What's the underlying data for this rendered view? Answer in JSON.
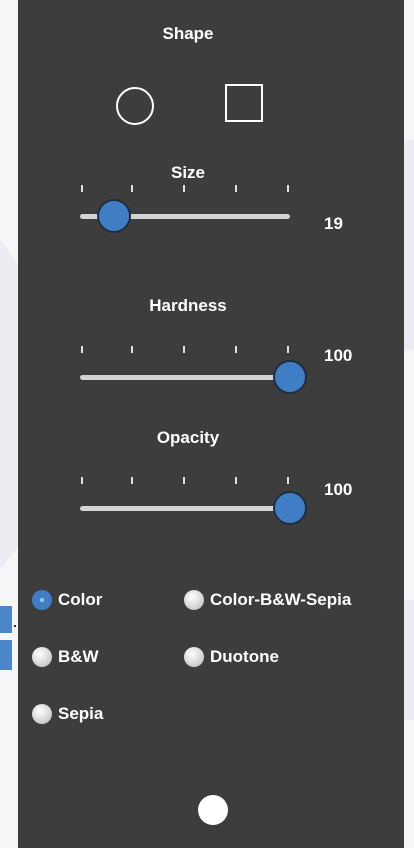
{
  "panel": {
    "shape": {
      "title": "Shape",
      "options": [
        "circle-icon",
        "square-icon"
      ]
    },
    "size": {
      "title": "Size",
      "value": "19",
      "fraction": 0.15
    },
    "hardness": {
      "title": "Hardness",
      "value": "100",
      "fraction": 1.0
    },
    "opacity": {
      "title": "Opacity",
      "value": "100",
      "fraction": 1.0
    },
    "color_modes": {
      "selected": "Color",
      "options": [
        "Color",
        "Color-B&W-Sepia",
        "B&W",
        "Duotone",
        "Sepia"
      ]
    }
  },
  "colors": {
    "panel_bg": "#3d3d3d",
    "accent": "#3f7ec4",
    "text": "#ffffff"
  }
}
